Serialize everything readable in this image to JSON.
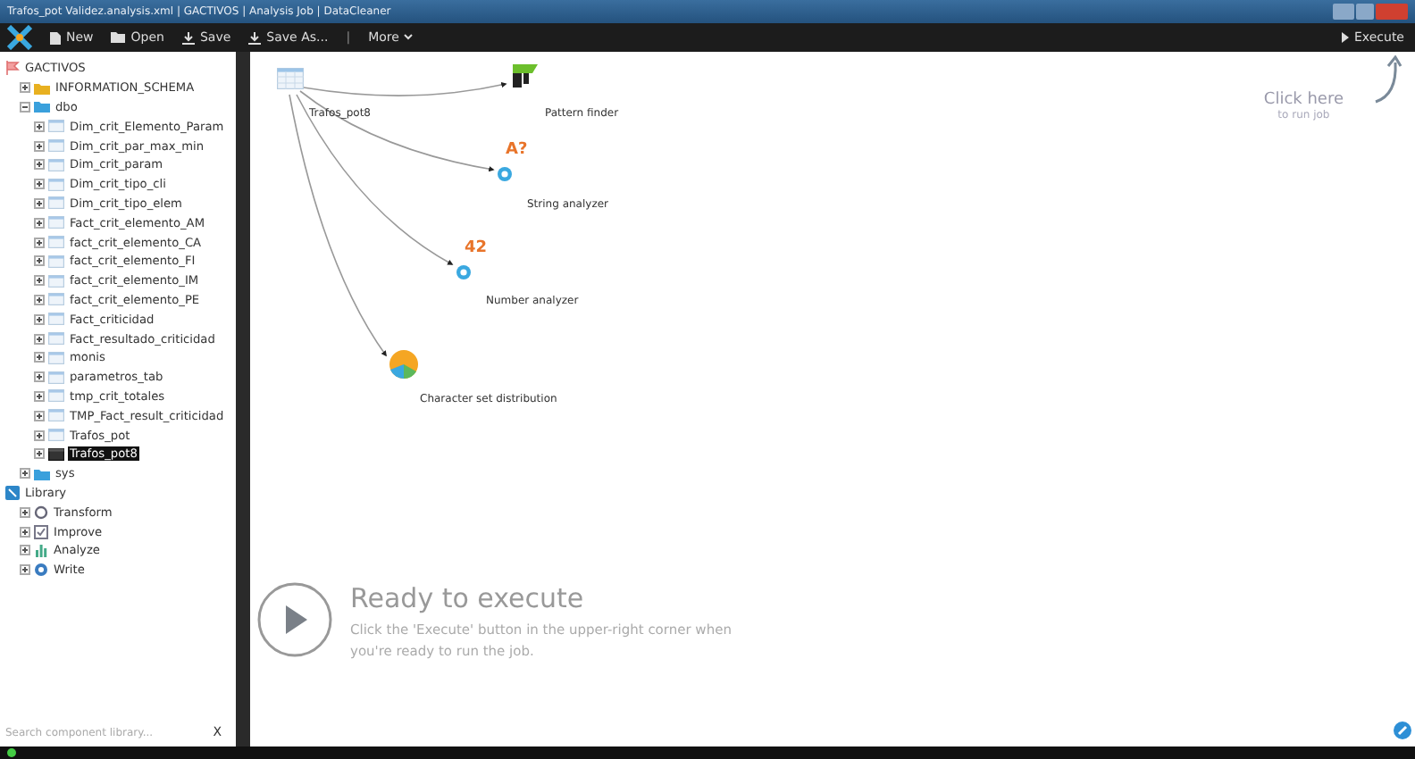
{
  "window": {
    "title": "Trafos_pot Validez.analysis.xml | GACTIVOS | Analysis Job | DataCleaner"
  },
  "toolbar": {
    "buttons": [
      {
        "label": "New",
        "kind": "new"
      },
      {
        "label": "Open",
        "kind": "open"
      },
      {
        "label": "Save",
        "kind": "save"
      },
      {
        "label": "Save As...",
        "kind": "save"
      }
    ],
    "separator": "|",
    "more": "More",
    "execute": "Execute"
  },
  "tree": [
    {
      "label": "GACTIVOS",
      "kind": "datastore",
      "children": [
        {
          "label": "INFORMATION_SCHEMA",
          "kind": "system-schema",
          "expanded": false,
          "selected": false
        },
        {
          "label": "dbo",
          "kind": "schema",
          "expanded": true,
          "selected": false,
          "children": [
            {
              "label": "Dim_crit_Elemento_Param",
              "kind": "table",
              "expanded": false,
              "selected": false
            },
            {
              "label": "Dim_crit_par_max_min",
              "kind": "table",
              "expanded": false,
              "selected": false
            },
            {
              "label": "Dim_crit_param",
              "kind": "table",
              "expanded": false,
              "selected": false
            },
            {
              "label": "Dim_crit_tipo_cli",
              "kind": "table",
              "expanded": false,
              "selected": false
            },
            {
              "label": "Dim_crit_tipo_elem",
              "kind": "table",
              "expanded": false,
              "selected": false
            },
            {
              "label": "Fact_crit_elemento_AM",
              "kind": "table",
              "expanded": false,
              "selected": false
            },
            {
              "label": "fact_crit_elemento_CA",
              "kind": "table",
              "expanded": false,
              "selected": false
            },
            {
              "label": "fact_crit_elemento_FI",
              "kind": "table",
              "expanded": false,
              "selected": false
            },
            {
              "label": "fact_crit_elemento_IM",
              "kind": "table",
              "expanded": false,
              "selected": false
            },
            {
              "label": "fact_crit_elemento_PE",
              "kind": "table",
              "expanded": false,
              "selected": false
            },
            {
              "label": "Fact_criticidad",
              "kind": "table",
              "expanded": false,
              "selected": false
            },
            {
              "label": "Fact_resultado_criticidad",
              "kind": "table",
              "expanded": false,
              "selected": false
            },
            {
              "label": "monis",
              "kind": "table",
              "expanded": false,
              "selected": false
            },
            {
              "label": "parametros_tab",
              "kind": "table",
              "expanded": false,
              "selected": false
            },
            {
              "label": "tmp_crit_totales",
              "kind": "table",
              "expanded": false,
              "selected": false
            },
            {
              "label": "TMP_Fact_result_criticidad",
              "kind": "table",
              "expanded": false,
              "selected": false
            },
            {
              "label": "Trafos_pot",
              "kind": "table",
              "expanded": false,
              "selected": false
            },
            {
              "label": "Trafos_pot8",
              "kind": "table",
              "expanded": false,
              "selected": true
            }
          ]
        },
        {
          "label": "sys",
          "kind": "schema",
          "expanded": false,
          "selected": false
        }
      ]
    },
    {
      "label": "Library",
      "kind": "library",
      "children": [
        {
          "label": "Transform",
          "kind": "transform",
          "expanded": false,
          "selected": false
        },
        {
          "label": "Improve",
          "kind": "improve",
          "expanded": false,
          "selected": false
        },
        {
          "label": "Analyze",
          "kind": "analyze",
          "expanded": false,
          "selected": false
        },
        {
          "label": "Write",
          "kind": "write",
          "expanded": false,
          "selected": false
        }
      ]
    }
  ],
  "search": {
    "placeholder": "Search component library...",
    "clear": "X"
  },
  "canvas": {
    "source": {
      "label": "Trafos_pot8"
    },
    "components": [
      {
        "label": "Pattern finder",
        "kind": "pattern"
      },
      {
        "label": "String analyzer",
        "kind": "string",
        "badge": "A?"
      },
      {
        "label": "Number analyzer",
        "kind": "number",
        "badge": "42"
      },
      {
        "label": "Character set distribution",
        "kind": "charset"
      }
    ],
    "hint": {
      "title": "Click here",
      "subtitle": "to run job"
    },
    "ready": {
      "title": "Ready to execute",
      "text": "Click the 'Execute' button in the upper-right corner when you're ready to run the job."
    }
  }
}
